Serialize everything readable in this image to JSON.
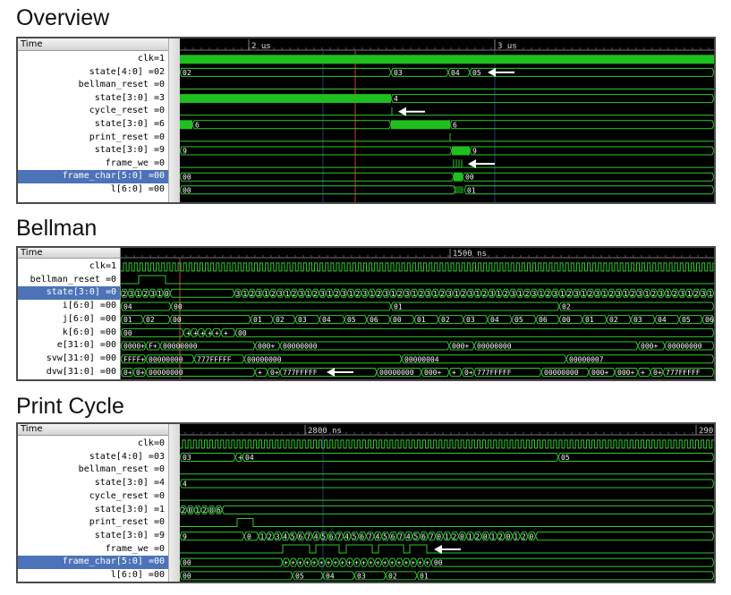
{
  "sections": [
    {
      "title": "Overview",
      "time_header": "Time",
      "time_ticks": [
        "2 us",
        "3 us"
      ],
      "signals": [
        {
          "label": "clk=1"
        },
        {
          "label": "state[4:0] =02"
        },
        {
          "label": "bellman_reset =0"
        },
        {
          "label": "state[3:0] =3"
        },
        {
          "label": "cycle_reset =0"
        },
        {
          "label": "state[3:0] =6"
        },
        {
          "label": "print_reset =0"
        },
        {
          "label": "state[3:0] =9"
        },
        {
          "label": "frame_we =0"
        },
        {
          "label": "frame_char[5:0] =00",
          "selected": true
        },
        {
          "label": "l[6:0] =00"
        }
      ]
    },
    {
      "title": "Bellman",
      "time_header": "Time",
      "time_ticks": [
        "1500 ns"
      ],
      "signals": [
        {
          "label": "clk=1"
        },
        {
          "label": "bellman_reset =0"
        },
        {
          "label": "state[3:0] =0",
          "selected": true
        },
        {
          "label": "i[6:0] =00"
        },
        {
          "label": "j[6:0] =00"
        },
        {
          "label": "k[6:0] =00"
        },
        {
          "label": "e[31:0] =00"
        },
        {
          "label": "svw[31:0] =00"
        },
        {
          "label": "dvw[31:0] =00"
        }
      ]
    },
    {
      "title": "Print Cycle",
      "time_header": "Time",
      "time_ticks": [
        "2800 ns",
        "290"
      ],
      "signals": [
        {
          "label": "clk=0"
        },
        {
          "label": "state[4:0] =03"
        },
        {
          "label": "bellman_reset =0"
        },
        {
          "label": "state[3:0] =4"
        },
        {
          "label": "cycle_reset =0"
        },
        {
          "label": "state[3:0] =1"
        },
        {
          "label": "print_reset =0"
        },
        {
          "label": "state[3:0] =9"
        },
        {
          "label": "frame_we =0"
        },
        {
          "label": "frame_char[5:0] =00",
          "selected": true
        },
        {
          "label": "l[6:0] =00"
        }
      ]
    }
  ],
  "overview_values": {
    "state5": [
      "02",
      "03",
      "04",
      "05"
    ],
    "bell_state": "4",
    "cyc_state": [
      "6",
      "6"
    ],
    "print_state": [
      "9",
      "9"
    ],
    "frame_char": [
      "00",
      "00"
    ],
    "l": [
      "00",
      "01"
    ]
  },
  "bellman_values": {
    "state": [
      "2",
      "3",
      "1",
      "2",
      "3",
      "1",
      "0",
      "3",
      "1",
      "2",
      "3",
      "1",
      "2",
      "3",
      "1",
      "2",
      "3",
      "1",
      "2",
      "3",
      "1",
      "2",
      "3",
      "1",
      "2",
      "3",
      "1",
      "2",
      "3",
      "1",
      "2",
      "3",
      "1",
      "2",
      "3",
      "1",
      "2",
      "3",
      "1",
      "2",
      "3",
      "1",
      "2",
      "3",
      "1",
      "2",
      "3",
      "1",
      "2",
      "3",
      "1",
      "2",
      "3",
      "1",
      "2",
      "3",
      "1",
      "2",
      "3",
      "1",
      "2",
      "3",
      "1",
      "2",
      "3",
      "1",
      "2",
      "3",
      "1",
      "2",
      "3",
      "1",
      "2",
      "3",
      "1",
      "2",
      "3",
      "1",
      "2",
      "3",
      "1",
      "2",
      "3",
      "1",
      "2",
      "3",
      "1",
      "2",
      "3",
      "1",
      "2",
      "3",
      "1",
      "2",
      "3",
      "1",
      "2",
      "3",
      "1",
      "2",
      "3",
      "1",
      "2",
      "3",
      "1",
      "2",
      "3",
      "1",
      "2",
      "3",
      "1",
      "2",
      "3",
      "1",
      "2",
      "3",
      "1",
      "2",
      "3",
      "1",
      "2"
    ],
    "i": [
      "04",
      "00",
      "01",
      "02"
    ],
    "j": [
      "01",
      "02",
      "00",
      "01",
      "02",
      "03",
      "04",
      "05",
      "06",
      "00",
      "01",
      "02",
      "03",
      "04",
      "05",
      "06",
      "00",
      "01",
      "02",
      "03",
      "04",
      "05",
      "06"
    ],
    "k": [
      "00",
      "+",
      "+",
      "+",
      "+",
      "+",
      "+",
      "00"
    ],
    "e": [
      "0000+",
      "F+",
      "00000000",
      "000+",
      "00000000",
      "000+",
      "00000000",
      "000+",
      "00000000"
    ],
    "svw": [
      "FFFF+",
      "00000000",
      "777FFFFF",
      "00000000",
      "00000004",
      "00000007"
    ],
    "dvw": [
      "0+",
      "0+",
      "00000000",
      "+",
      "0+",
      "777FFFFF",
      "00000000",
      "000+",
      "+",
      "0+",
      "777FFFFF",
      "00000000",
      "000+",
      "000+",
      "+",
      "0+",
      "777FFFFF"
    ]
  },
  "print_values": {
    "state5": [
      "03",
      "+",
      "04",
      "05"
    ],
    "bell_state": "4",
    "cyc_state": [
      "2",
      "0",
      "1",
      "2",
      "0",
      "6"
    ],
    "print_state": [
      "9",
      "0",
      "1",
      "2",
      "3",
      "4",
      "5",
      "6",
      "7",
      "4",
      "5",
      "6",
      "7",
      "4",
      "5",
      "6",
      "7",
      "4",
      "5",
      "6",
      "7",
      "4",
      "5",
      "6",
      "7",
      "0",
      "1",
      "2",
      "0",
      "1",
      "2",
      "0",
      "1",
      "2",
      "0",
      "1",
      "2",
      "0",
      "9"
    ],
    "frame_char_tail": "00",
    "l": [
      "00",
      "05",
      "04",
      "03",
      "02",
      "01"
    ]
  },
  "colors": {
    "wave": "#2ec92e",
    "bus_fill": "#1fbf1f",
    "bg": "#000000",
    "cursor": "#d23c3c",
    "select": "#4c73b8"
  },
  "icons": [
    "left-arrow-icon"
  ]
}
